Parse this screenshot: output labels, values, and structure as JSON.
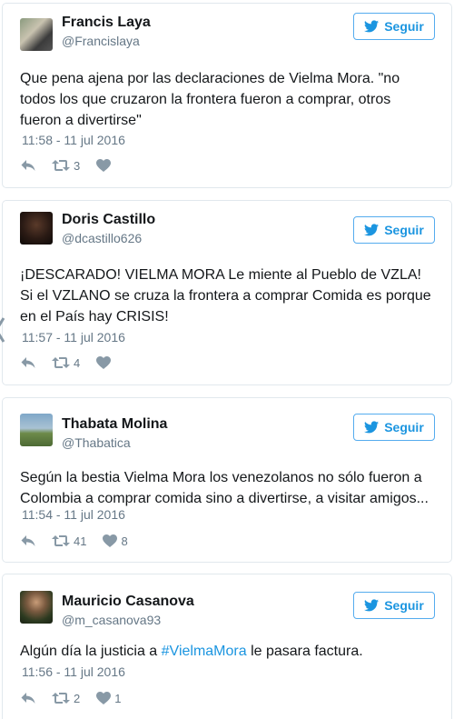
{
  "tweets": [
    {
      "name": "Francis Laya",
      "handle": "@Francislaya",
      "follow_label": "Seguir",
      "text": "Que pena ajena por las declaraciones de Vielma Mora. \"no todos los que cruzaron la frontera fueron a comprar, otros fueron a divertirse\"",
      "time": "11:58 - 11 jul 2016",
      "retweets": "3",
      "likes": ""
    },
    {
      "name": "Doris Castillo",
      "handle": "@dcastillo626",
      "follow_label": "Seguir",
      "text": "¡DESCARADO! VIELMA MORA Le miente al Pueblo de VZLA! Si el VZLANO se cruza la frontera a comprar Comida es porque en el País hay CRISIS!",
      "time": "11:57 - 11 jul 2016",
      "retweets": "4",
      "likes": ""
    },
    {
      "name": "Thabata Molina",
      "handle": "@Thabatica",
      "follow_label": "Seguir",
      "text": "Según la bestia Vielma Mora los venezolanos no sólo fueron a Colombia a comprar comida sino a divertirse, a visitar amigos...",
      "time": "11:54 - 11 jul 2016",
      "retweets": "41",
      "likes": "8"
    },
    {
      "name": "Mauricio Casanova",
      "handle": "@m_casanova93",
      "follow_label": "Seguir",
      "text_before": "Algún día la justicia a ",
      "hashtag": "#VielmaMora",
      "text_after": " le pasara factura.",
      "time": "11:56 - 11 jul 2016",
      "retweets": "2",
      "likes": "1"
    }
  ],
  "colors": {
    "accent": "#1b95e0",
    "border": "#e1e8ed",
    "muted": "#657786"
  }
}
